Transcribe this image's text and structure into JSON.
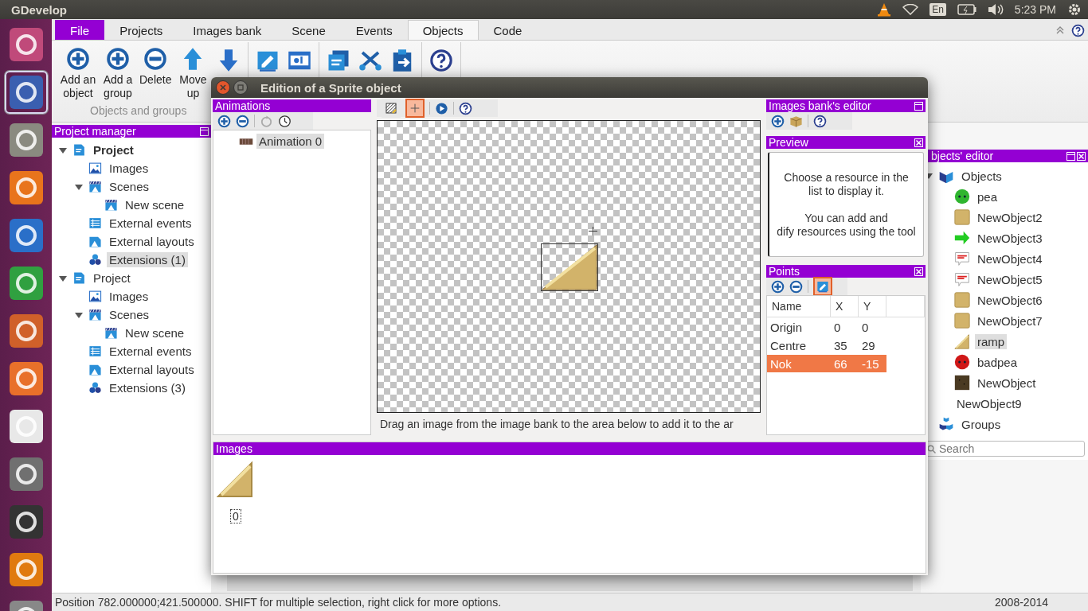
{
  "top_bar": {
    "title": "GDevelop",
    "keyboard": "En",
    "time": "5:23 PM"
  },
  "launcher": [
    {
      "kind": "ubuntu",
      "selected": false
    },
    {
      "kind": "gdevelop",
      "selected": true
    },
    {
      "kind": "files",
      "selected": false
    },
    {
      "kind": "firefox",
      "selected": false
    },
    {
      "kind": "writer",
      "selected": false
    },
    {
      "kind": "calc",
      "selected": false
    },
    {
      "kind": "impress",
      "selected": false
    },
    {
      "kind": "software",
      "selected": false
    },
    {
      "kind": "amazon",
      "selected": false
    },
    {
      "kind": "settings",
      "selected": false
    },
    {
      "kind": "terminal",
      "selected": false
    },
    {
      "kind": "vlc",
      "selected": false
    },
    {
      "kind": "trash",
      "selected": false
    }
  ],
  "tabs": [
    {
      "label": "File",
      "kind": "menu",
      "selected": false
    },
    {
      "label": "Projects",
      "kind": "tab",
      "selected": false
    },
    {
      "label": "Images bank",
      "kind": "tab",
      "selected": false
    },
    {
      "label": "Scene",
      "kind": "tab",
      "selected": false
    },
    {
      "label": "Events",
      "kind": "tab",
      "selected": false
    },
    {
      "label": "Objects",
      "kind": "tab",
      "selected": true
    },
    {
      "label": "Code",
      "kind": "tab",
      "selected": false
    }
  ],
  "ribbon": {
    "groups": [
      {
        "label": "Objects and groups",
        "buttons": [
          {
            "kind": "add",
            "label": "Add an object"
          },
          {
            "kind": "add",
            "label": "Add a group"
          },
          {
            "kind": "remove",
            "label": "Delete"
          },
          {
            "kind": "up",
            "label": "Move up"
          },
          {
            "kind": "down"
          }
        ]
      },
      {
        "buttons": [
          {
            "kind": "edit"
          },
          {
            "kind": "rename"
          }
        ]
      },
      {
        "buttons": [
          {
            "kind": "copy"
          },
          {
            "kind": "cut"
          },
          {
            "kind": "paste"
          }
        ]
      },
      {
        "buttons": [
          {
            "kind": "help"
          }
        ]
      }
    ]
  },
  "project_manager": {
    "title": "Project manager",
    "items": [
      {
        "label": "Project",
        "kind": "project",
        "current": true,
        "selected": false,
        "expanded": true,
        "children": [
          {
            "label": "Images",
            "kind": "images",
            "selected": false
          },
          {
            "label": "Scenes",
            "kind": "scenes",
            "selected": false,
            "expanded": true,
            "children": [
              {
                "label": "New scene",
                "kind": "scenes",
                "selected": false
              }
            ]
          },
          {
            "label": "External events",
            "kind": "events",
            "selected": false
          },
          {
            "label": "External layouts",
            "kind": "layouts",
            "selected": false
          },
          {
            "label": "Extensions (1)",
            "kind": "extensions",
            "selected": true
          }
        ]
      },
      {
        "label": "Project",
        "kind": "project",
        "current": false,
        "selected": false,
        "expanded": true,
        "children": [
          {
            "label": "Images",
            "kind": "images",
            "selected": false
          },
          {
            "label": "Scenes",
            "kind": "scenes",
            "selected": false,
            "expanded": true,
            "children": [
              {
                "label": "New scene",
                "kind": "scenes",
                "selected": false
              }
            ]
          },
          {
            "label": "External events",
            "kind": "events",
            "selected": false
          },
          {
            "label": "External layouts",
            "kind": "layouts",
            "selected": false
          },
          {
            "label": "Extensions (3)",
            "kind": "extensions",
            "selected": false
          }
        ]
      }
    ]
  },
  "objects_editor": {
    "title": "bjects' editor",
    "items": [
      {
        "label": "Objects",
        "kind": "objects",
        "selected": false,
        "expanded": true,
        "children": [
          {
            "label": "pea",
            "kind": "pea",
            "selected": false
          },
          {
            "label": "NewObject2",
            "kind": "box",
            "selected": false
          },
          {
            "label": "NewObject3",
            "kind": "arrow",
            "selected": false
          },
          {
            "label": "NewObject4",
            "kind": "bubble",
            "selected": false
          },
          {
            "label": "NewObject5",
            "kind": "bubble",
            "selected": false
          },
          {
            "label": "NewObject6",
            "kind": "box",
            "selected": false
          },
          {
            "label": "NewObject7",
            "kind": "box",
            "selected": false
          },
          {
            "label": "ramp",
            "kind": "ramp",
            "selected": true
          },
          {
            "label": "badpea",
            "kind": "badpea",
            "selected": false
          },
          {
            "label": "NewObject",
            "kind": "dirt",
            "selected": false
          },
          {
            "label": "NewObject9",
            "kind": "none",
            "selected": false
          }
        ]
      },
      {
        "label": "Groups",
        "kind": "groups",
        "selected": false
      }
    ],
    "search": {
      "placeholder": "Search"
    }
  },
  "dialog": {
    "title": "Edition of a Sprite object",
    "animations": {
      "title": "Animations",
      "toolbar": [
        {
          "kind": "add"
        },
        {
          "kind": "remove"
        },
        {
          "kind": "sep"
        },
        {
          "kind": "loop"
        },
        {
          "kind": "clock"
        }
      ],
      "items": [
        {
          "label": "Animation 0",
          "selected": true
        }
      ]
    },
    "editor_toolbar": [
      {
        "kind": "mask",
        "on": false
      },
      {
        "kind": "points",
        "on": true
      },
      {
        "kind": "sep"
      },
      {
        "kind": "play"
      },
      {
        "kind": "sep"
      },
      {
        "kind": "help"
      }
    ],
    "hint": "Drag an image from the image bank to the area below to add it to the ar",
    "images_bank": {
      "title": "Images bank's editor",
      "toolbar": [
        {
          "kind": "add"
        },
        {
          "kind": "package"
        },
        {
          "kind": "sep"
        },
        {
          "kind": "help"
        }
      ]
    },
    "preview": {
      "title": "Preview",
      "lines": [
        "Choose a resource in the",
        "list to display it.",
        "You can add and",
        "dify resources using the tool"
      ]
    },
    "points": {
      "title": "Points",
      "toolbar": [
        {
          "kind": "add"
        },
        {
          "kind": "remove"
        },
        {
          "kind": "sep"
        },
        {
          "kind": "edit",
          "on": true
        }
      ],
      "columns": [
        "Name",
        "X",
        "Y"
      ],
      "rows": [
        {
          "cells": [
            "Origin",
            "0",
            "0"
          ],
          "selected": false
        },
        {
          "cells": [
            "Centre",
            "35",
            "29"
          ],
          "selected": false
        },
        {
          "cells": [
            "Nok",
            "66",
            "-15"
          ],
          "selected": true
        }
      ]
    },
    "images": {
      "title": "Images",
      "items": [
        {
          "label": "0",
          "selected": true
        }
      ]
    }
  },
  "status_bar": {
    "text": "Position 782.000000;421.500000. SHIFT for multiple selection, right click for more options.",
    "copyright": "2008-2014"
  }
}
